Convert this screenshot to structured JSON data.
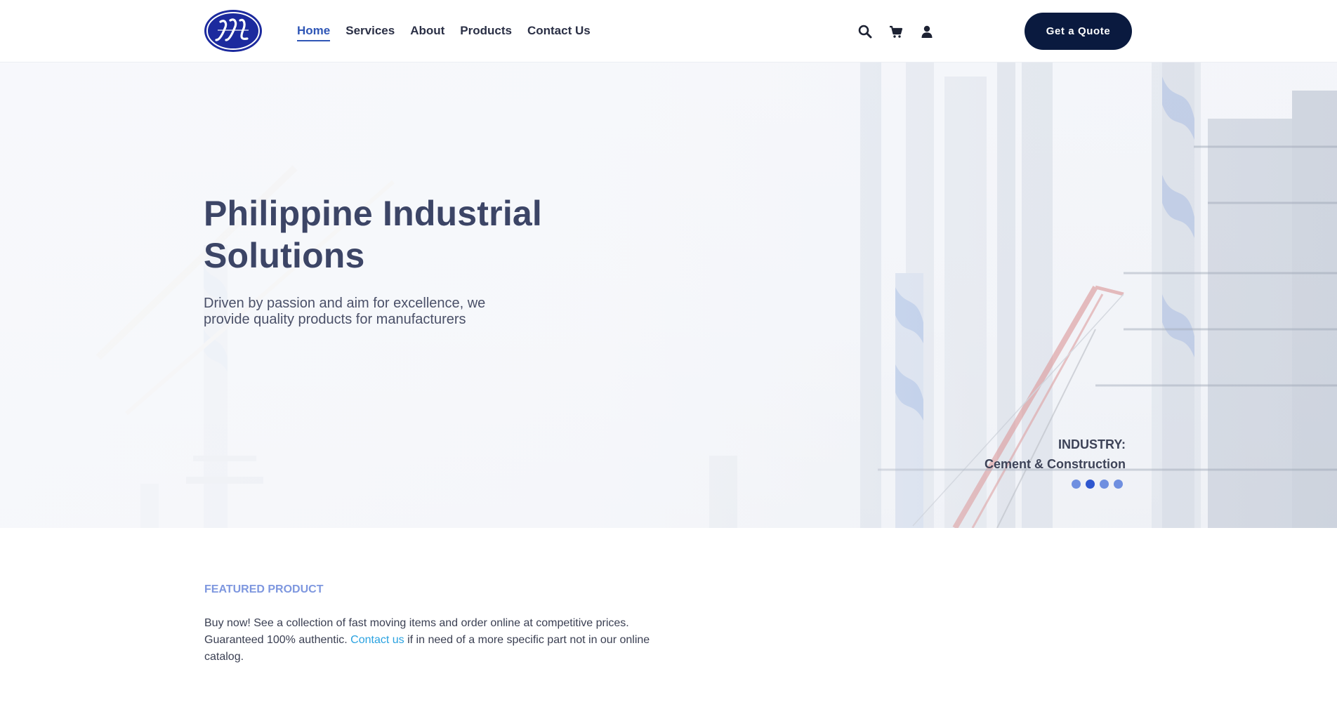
{
  "header": {
    "logo_text": "JJL",
    "nav": [
      {
        "label": "Home",
        "active": true
      },
      {
        "label": "Services",
        "active": false
      },
      {
        "label": "About",
        "active": false
      },
      {
        "label": "Products",
        "active": false
      },
      {
        "label": "Contact Us",
        "active": false
      }
    ],
    "icons": [
      "search-icon",
      "cart-icon",
      "user-icon"
    ],
    "cta_label": "Get a Quote"
  },
  "hero": {
    "title": "Philippine Industrial Solutions",
    "subtitle": "Driven by passion and aim for excellence, we provide quality products for manufacturers",
    "industry_label": "INDUSTRY:",
    "industry_value": "Cement & Construction",
    "slide_count": 4,
    "active_slide": 2
  },
  "featured": {
    "label": "FEATURED PRODUCT",
    "text_before": "Buy now! See a collection of fast moving items and order online at competitive prices. Guaranteed 100% authentic.",
    "link": "Contact us",
    "text_after": "if in need of a more specific part not in our online catalog."
  },
  "colors": {
    "brand_navy": "#0a1a3f",
    "brand_blue": "#2f56b6",
    "accent_link": "#2aa2e0",
    "featured_label": "#7e97df"
  }
}
